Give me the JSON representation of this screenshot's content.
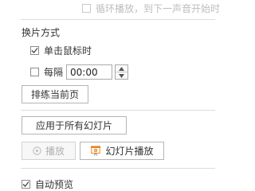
{
  "loop_option": {
    "label": "循环播放，到下一声音开始时",
    "checked": false
  },
  "transition_section": {
    "title": "换片方式"
  },
  "on_click": {
    "label": "单击鼠标时",
    "checked": true
  },
  "every_interval": {
    "label": "每隔",
    "checked": false,
    "value": "00:00"
  },
  "rehearse_button": {
    "label": "排练当前页"
  },
  "apply_all_button": {
    "label": "应用于所有幻灯片"
  },
  "play_button": {
    "label": "播放",
    "icon": "play-circle-icon"
  },
  "slideshow_button": {
    "label": "幻灯片播放",
    "icon": "slideshow-icon"
  },
  "auto_preview": {
    "label": "自动预览",
    "checked": true
  },
  "colors": {
    "accent": "#f08a24",
    "border": "#b5b5b5",
    "disabled": "#b0b0b0"
  }
}
